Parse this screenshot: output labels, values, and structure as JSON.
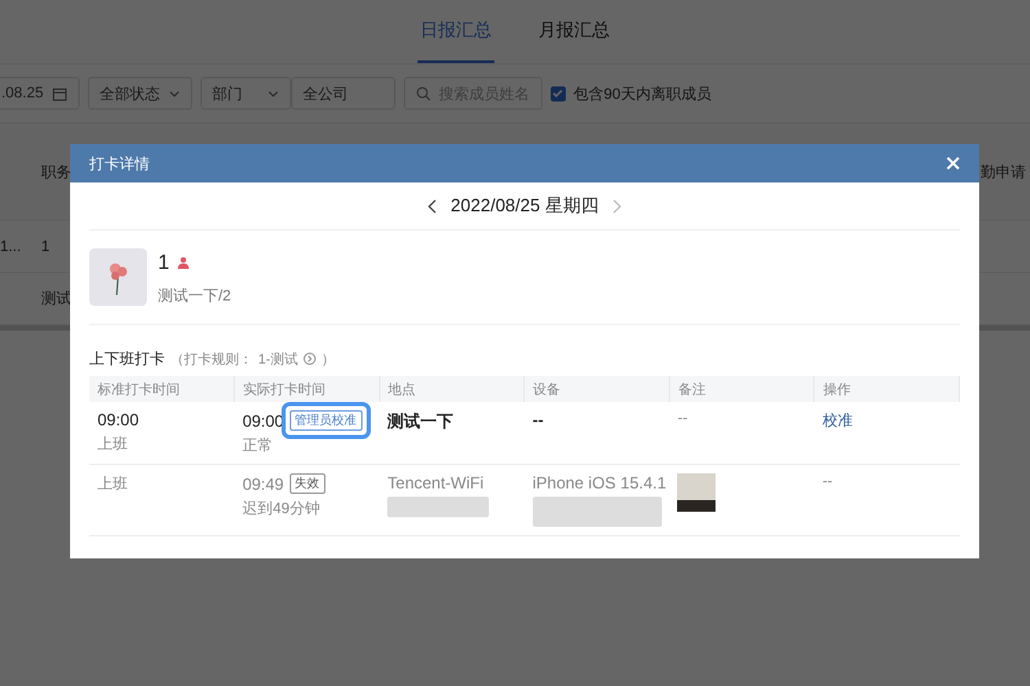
{
  "tabs": [
    {
      "label": "日报汇总",
      "selected": true
    },
    {
      "label": "月报汇总",
      "selected": false
    }
  ],
  "filters": {
    "date": ".08.25",
    "status": "全部状态",
    "dept_label": "部门",
    "dept_value": "全公司",
    "search": {
      "placeholder": "搜索成员姓名"
    },
    "include_left": {
      "label": "包含90天内离职成员",
      "checked": true
    }
  },
  "background_table": {
    "headers": [
      "职务",
      "勤申请"
    ],
    "rows": [
      [
        "1...",
        "1"
      ],
      [
        "",
        "测试"
      ]
    ]
  },
  "dialog": {
    "title": "打卡详情",
    "date": "2022/08/25 星期四",
    "user": {
      "name": "1",
      "dept": "测试一下/2"
    },
    "section": {
      "title": "上下班打卡",
      "rule_prefix": "（打卡规则：",
      "rule": "1-测试",
      "rule_suffix": "）"
    },
    "columns": [
      "标准打卡时间",
      "实际打卡时间",
      "地点",
      "设备",
      "备注",
      "操作"
    ],
    "rows": [
      {
        "kind": "main",
        "std_time": "09:00",
        "std_label": "上班",
        "actual_time": "09:00",
        "tag": "管理员校准",
        "tag_highlighted": true,
        "status": "正常",
        "location": "测试一下",
        "device": "--",
        "note": "--",
        "action": "校准"
      },
      {
        "kind": "record",
        "std_label": "上班",
        "actual_time": "09:49",
        "tag": "失效",
        "status": "迟到49分钟",
        "location": "Tencent-WiFi",
        "device": "iPhone iOS 15.4.1",
        "action": "--"
      }
    ]
  }
}
